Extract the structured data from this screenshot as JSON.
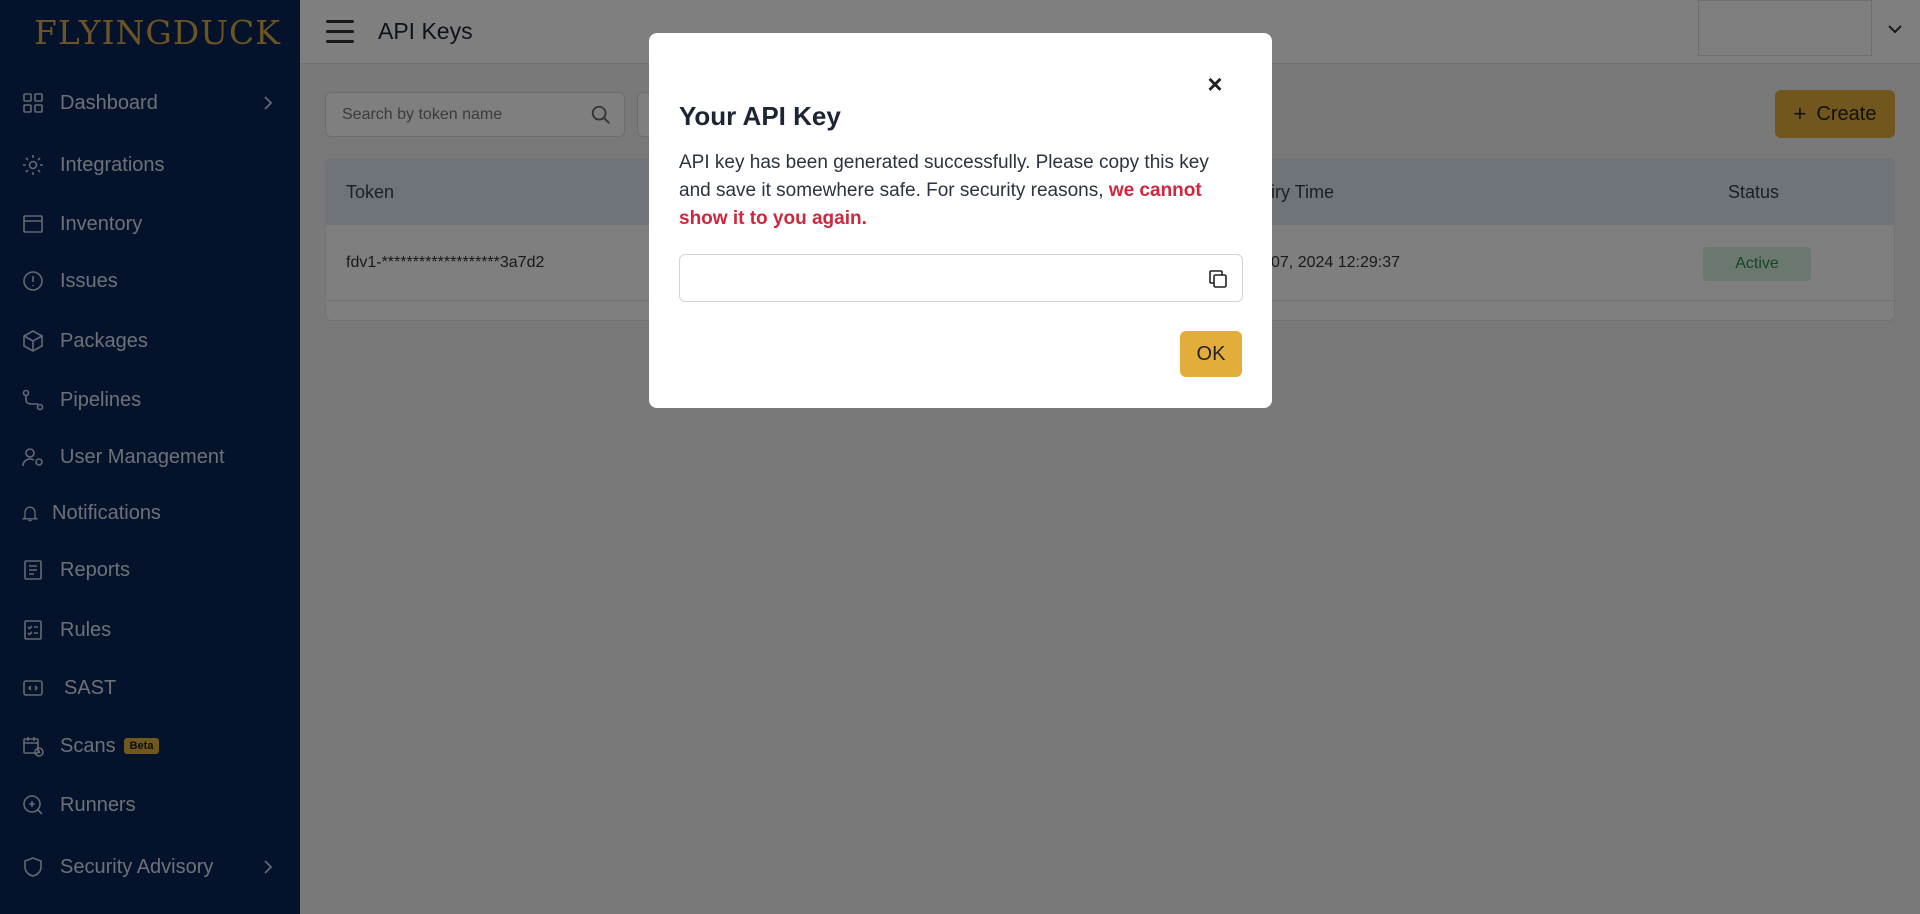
{
  "brand": {
    "logo_part1": "FLYING",
    "logo_part2": "DUCK"
  },
  "sidebar": {
    "items": [
      {
        "label": "Dashboard",
        "icon": "grid-icon",
        "has_chevron": true
      },
      {
        "label": "Integrations",
        "icon": "gear-icon"
      },
      {
        "label": "Inventory",
        "icon": "window-icon"
      },
      {
        "label": "Issues",
        "icon": "alert-circle-icon"
      },
      {
        "label": "Packages",
        "icon": "package-box-icon"
      },
      {
        "label": "Pipelines",
        "icon": "pipeline-icon"
      },
      {
        "label": "User Management",
        "icon": "user-gear-icon"
      },
      {
        "label": "Notifications",
        "icon": "bell-icon"
      },
      {
        "label": "Reports",
        "icon": "report-icon"
      },
      {
        "label": "Rules",
        "icon": "checklist-icon"
      },
      {
        "label": "SAST",
        "icon": "code-icon"
      },
      {
        "label": "Scans",
        "icon": "calendar-clock-icon",
        "badge": "Beta"
      },
      {
        "label": "Runners",
        "icon": "runner-search-icon"
      },
      {
        "label": "Security Advisory",
        "icon": "shield-icon",
        "has_chevron": true
      }
    ]
  },
  "header": {
    "title": "API Keys"
  },
  "toolbar": {
    "search_placeholder": "Search by token name",
    "create_label": "Create"
  },
  "table": {
    "headers": [
      "Token",
      "iry Time",
      "Status"
    ],
    "rows": [
      {
        "token": "fdv1-*******************3a7d2",
        "expiry": "07, 2024 12:29:37",
        "status": "Active"
      }
    ]
  },
  "modal": {
    "title": "Your API Key",
    "text_main": "API key has been generated successfully. Please copy this key and save it somewhere safe. For security reasons, ",
    "text_warning": "we cannot show it to you again.",
    "ok_label": "OK",
    "close_symbol": "×"
  },
  "colors": {
    "sidebar_bg": "#0a2458",
    "accent": "#e2ad3b",
    "warning": "#d1263d",
    "status_active": "#2f8a4c"
  }
}
